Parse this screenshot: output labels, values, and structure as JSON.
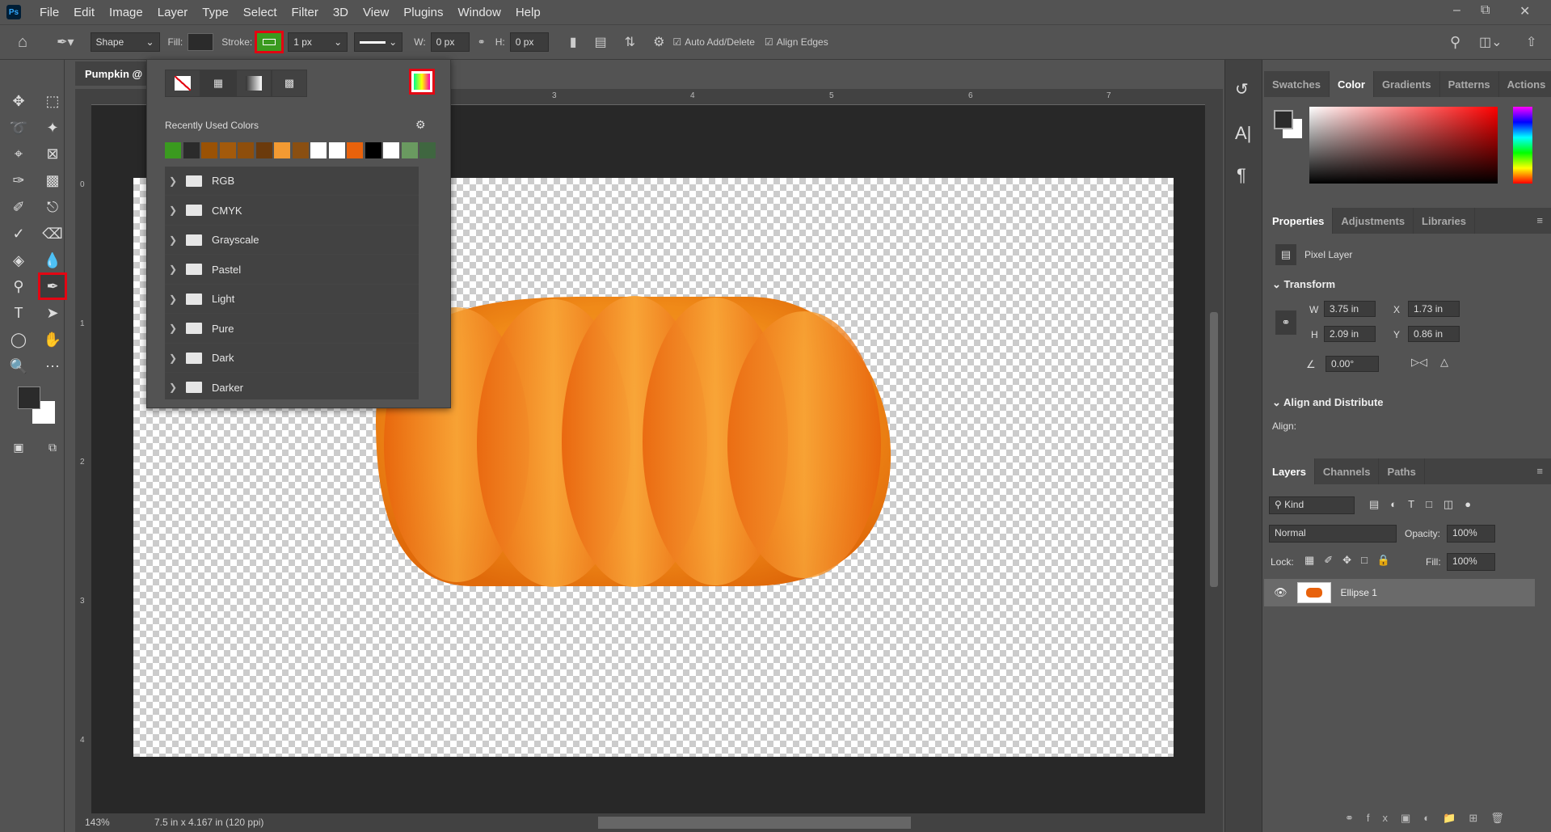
{
  "menu": [
    "File",
    "Edit",
    "Image",
    "Layer",
    "Type",
    "Select",
    "Filter",
    "3D",
    "View",
    "Plugins",
    "Window",
    "Help"
  ],
  "app_logo": "Ps",
  "options": {
    "mode": "Shape",
    "fill_label": "Fill:",
    "stroke_label": "Stroke:",
    "stroke_width": "1 px",
    "w_label": "W:",
    "w_value": "0 px",
    "h_label": "H:",
    "h_value": "0 px",
    "auto_add_delete": "Auto Add/Delete",
    "align_edges": "Align Edges",
    "stroke_color": "#3a9a1f",
    "fill_color": "#2b2b2b"
  },
  "document": {
    "tab_title": "Pumpkin @",
    "zoom": "143%",
    "doc_info": "7.5 in x 4.167 in (120 ppi)",
    "ruler_top": [
      "3",
      "4",
      "5",
      "6",
      "7"
    ],
    "ruler_left": [
      "0",
      "1",
      "2",
      "3",
      "4"
    ]
  },
  "swatch_popup": {
    "recent_label": "Recently Used Colors",
    "recent_colors": [
      "#3a9a1f",
      "#2b2b2b",
      "#9a5205",
      "#a35a0c",
      "#8e4e0c",
      "#6b3a0c",
      "#f39a32",
      "#8a4f12",
      "#ffffff",
      "#ffffff",
      "#e8620c",
      "#000000",
      "#ffffff",
      "#6a9a60",
      "#3f6640"
    ],
    "folders": [
      "RGB",
      "CMYK",
      "Grayscale",
      "Pastel",
      "Light",
      "Pure",
      "Dark",
      "Darker"
    ]
  },
  "color_panel": {
    "tabs": [
      "Swatches",
      "Color",
      "Gradients",
      "Patterns",
      "Actions"
    ],
    "active": "Color"
  },
  "properties": {
    "tabs": [
      "Properties",
      "Adjustments",
      "Libraries"
    ],
    "layer_type": "Pixel Layer",
    "transform_title": "Transform",
    "w_label": "W",
    "w": "3.75 in",
    "h_label": "H",
    "h": "2.09 in",
    "x_label": "X",
    "x": "1.73 in",
    "y_label": "Y",
    "y": "0.86 in",
    "angle": "0.00°",
    "align_title": "Align and Distribute",
    "align_label": "Align:"
  },
  "layers": {
    "tabs": [
      "Layers",
      "Channels",
      "Paths"
    ],
    "filter": "Kind",
    "blend": "Normal",
    "opacity_label": "Opacity:",
    "opacity": "100%",
    "lock_label": "Lock:",
    "fill_label": "Fill:",
    "fill": "100%",
    "items": [
      {
        "name": "Ellipse 1",
        "visible": true
      }
    ]
  }
}
